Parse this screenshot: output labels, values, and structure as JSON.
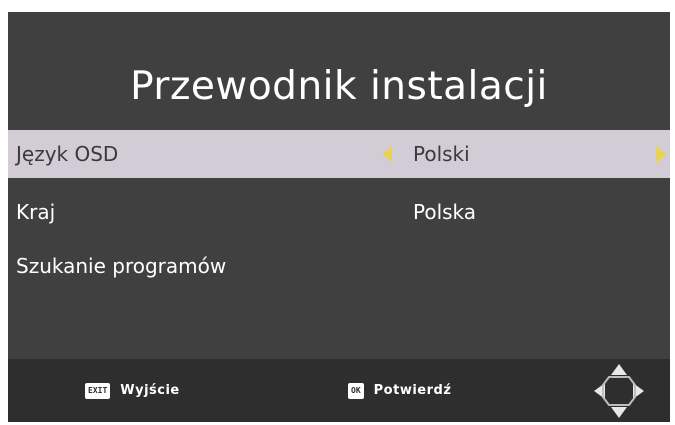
{
  "title": "Przewodnik instalacji",
  "settings": [
    {
      "label": "Język OSD",
      "value": "Polski",
      "selected": true
    },
    {
      "label": "Kraj",
      "value": "Polska",
      "selected": false
    },
    {
      "label": "Szukanie programów",
      "value": "",
      "selected": false
    }
  ],
  "footer": {
    "exit_key": "EXIT",
    "exit_label": "Wyjście",
    "ok_key": "OK",
    "ok_label": "Potwierdź",
    "nav_icon": "dpad-icon"
  },
  "colors": {
    "background": "#404040",
    "selection": "#d2ccd6",
    "arrow": "#e8d35a",
    "footer": "#2e2e2e"
  }
}
